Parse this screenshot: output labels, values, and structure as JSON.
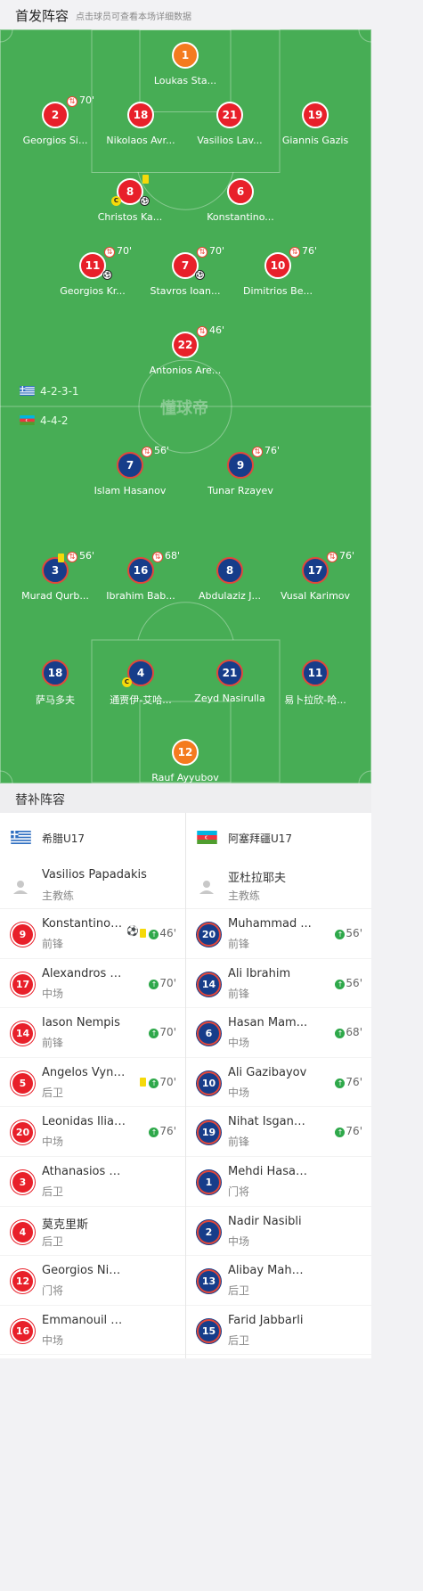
{
  "header": {
    "title": "首发阵容",
    "subtitle": "点击球员可查看本场详细数据"
  },
  "watermark": "懂球帝",
  "formations": {
    "home": "4-2-3-1",
    "away": "4-4-2"
  },
  "home_lineup": [
    {
      "num": "1",
      "name": "Loukas Sta...",
      "gk": true
    },
    {
      "num": "2",
      "name": "Georgios Si...",
      "sub": "70'"
    },
    {
      "num": "18",
      "name": "Nikolaos Avr..."
    },
    {
      "num": "21",
      "name": "Vasilios Lav..."
    },
    {
      "num": "19",
      "name": "Giannis Gazis"
    },
    {
      "num": "8",
      "name": "Christos Ka...",
      "captain": "C",
      "yellow": true,
      "goal": true
    },
    {
      "num": "6",
      "name": "Konstantino..."
    },
    {
      "num": "11",
      "name": "Georgios Kr...",
      "sub": "70'",
      "goal": true
    },
    {
      "num": "7",
      "name": "Stavros Ioan...",
      "sub": "70'",
      "goal": true
    },
    {
      "num": "10",
      "name": "Dimitrios Be...",
      "sub": "76'"
    },
    {
      "num": "22",
      "name": "Antonios Are...",
      "sub": "46'"
    }
  ],
  "away_lineup": [
    {
      "num": "7",
      "name": "Islam Hasanov",
      "sub": "56'"
    },
    {
      "num": "9",
      "name": "Tunar Rzayev",
      "sub": "76'"
    },
    {
      "num": "3",
      "name": "Murad Qurb...",
      "sub": "56'",
      "yellow": true
    },
    {
      "num": "16",
      "name": "Ibrahim Bab...",
      "sub": "68'"
    },
    {
      "num": "8",
      "name": "Abdulaziz J..."
    },
    {
      "num": "17",
      "name": "Vusal Karimov",
      "sub": "76'"
    },
    {
      "num": "18",
      "name": "萨马多夫"
    },
    {
      "num": "4",
      "name": "通贾伊-艾哈...",
      "captain": "C"
    },
    {
      "num": "21",
      "name": "Zeyd Nasirulla"
    },
    {
      "num": "11",
      "name": "易卜拉欣-哈..."
    },
    {
      "num": "12",
      "name": "Rauf Ayyubov",
      "gk": true
    }
  ],
  "subs_section": {
    "title": "替补阵容"
  },
  "home_team": {
    "name": "希腊U17",
    "coach": {
      "name": "Vasilios Papadakis",
      "role": "主教练"
    },
    "subs": [
      {
        "num": "9",
        "name": "Konstantinos ...",
        "pos": "前锋",
        "time": "46'",
        "goal": true,
        "yellow": true
      },
      {
        "num": "17",
        "name": "Alexandros M...",
        "pos": "中场",
        "time": "70'"
      },
      {
        "num": "14",
        "name": "Iason Nempis",
        "pos": "前锋",
        "time": "70'"
      },
      {
        "num": "5",
        "name": "Angelos Vyntra",
        "pos": "后卫",
        "time": "70'",
        "yellow": true
      },
      {
        "num": "20",
        "name": "Leonidas Ilias...",
        "pos": "中场",
        "time": "76'"
      },
      {
        "num": "3",
        "name": "Athanasios C...",
        "pos": "后卫"
      },
      {
        "num": "4",
        "name": "莫克里斯",
        "pos": "后卫"
      },
      {
        "num": "12",
        "name": "Georgios Nik...",
        "pos": "门将"
      },
      {
        "num": "16",
        "name": "Emmanouil C...",
        "pos": "中场"
      }
    ]
  },
  "away_team": {
    "name": "阿塞拜疆U17",
    "coach": {
      "name": "亚杜拉耶夫",
      "role": "主教练"
    },
    "subs": [
      {
        "num": "20",
        "name": "Muhammad ...",
        "pos": "前锋",
        "time": "56'"
      },
      {
        "num": "14",
        "name": "Ali Ibrahim",
        "pos": "前锋",
        "time": "56'"
      },
      {
        "num": "6",
        "name": "Hasan Mam...",
        "pos": "中场",
        "time": "68'"
      },
      {
        "num": "10",
        "name": "Ali Gazibayov",
        "pos": "中场",
        "time": "76'"
      },
      {
        "num": "19",
        "name": "Nihat Isganda...",
        "pos": "前锋",
        "time": "76'"
      },
      {
        "num": "1",
        "name": "Mehdi Hasanov",
        "pos": "门将"
      },
      {
        "num": "2",
        "name": "Nadir Nasibli",
        "pos": "中场"
      },
      {
        "num": "13",
        "name": "Alibay Mahm...",
        "pos": "后卫"
      },
      {
        "num": "15",
        "name": "Farid Jabbarli",
        "pos": "后卫"
      }
    ]
  }
}
